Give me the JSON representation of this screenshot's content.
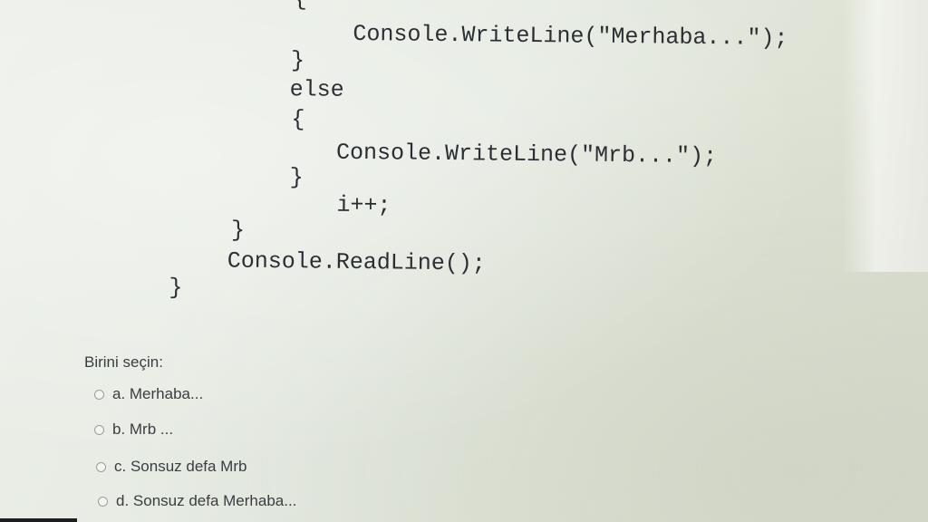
{
  "code": {
    "lines": [
      {
        "id": "brace-open-top",
        "text": "{"
      },
      {
        "id": "writeline-merhaba",
        "text": "Console.WriteLine(\"Merhaba...\");"
      },
      {
        "id": "brace-close-if",
        "text": "}"
      },
      {
        "id": "else-keyword",
        "text": "else"
      },
      {
        "id": "brace-open-else",
        "text": "{"
      },
      {
        "id": "writeline-mrb",
        "text": "Console.WriteLine(\"Mrb...\");"
      },
      {
        "id": "brace-close-else",
        "text": "}"
      },
      {
        "id": "increment",
        "text": "i++;"
      },
      {
        "id": "brace-close-loop",
        "text": "}"
      },
      {
        "id": "readline",
        "text": "Console.ReadLine();"
      },
      {
        "id": "brace-close-main",
        "text": "}"
      }
    ]
  },
  "quiz": {
    "prompt": "Birini seçin:",
    "options": [
      {
        "label": "a. Merhaba..."
      },
      {
        "label": "b. Mrb ..."
      },
      {
        "label": "c. Sonsuz defa Mrb"
      },
      {
        "label": "d. Sonsuz defa Merhaba..."
      }
    ]
  }
}
